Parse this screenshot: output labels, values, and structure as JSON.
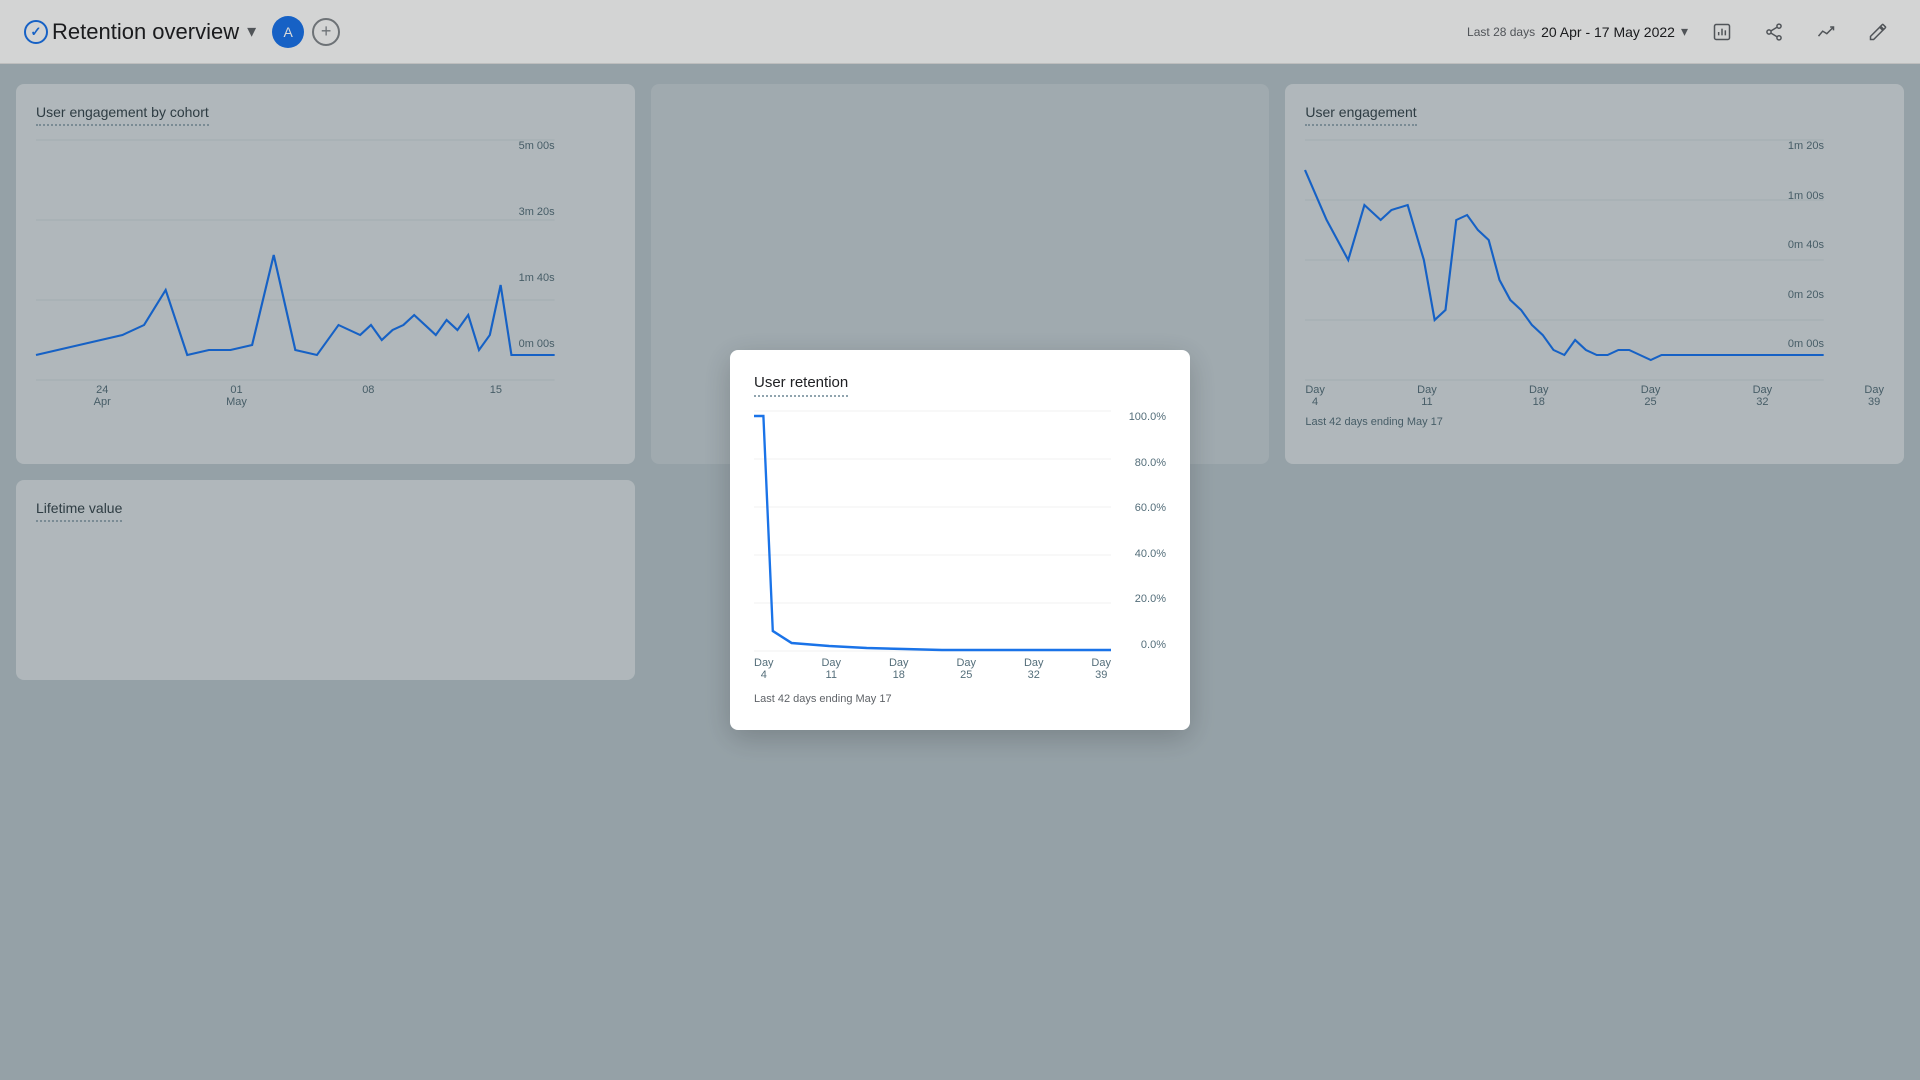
{
  "header": {
    "title": "Retention overview",
    "check_icon": "check-circle-icon",
    "dropdown_icon": "▾",
    "avatar_label": "A",
    "add_icon": "+",
    "date_range_label": "Last 28 days",
    "date_range_value": "20 Apr - 17 May 2022",
    "date_range_arrow": "▾",
    "toolbar_icons": [
      "report-icon",
      "share-icon",
      "trend-icon",
      "edit-icon"
    ]
  },
  "cards": [
    {
      "id": "user-engagement-cohort",
      "title": "User engagement by cohort",
      "y_labels": [
        "5m 00s",
        "3m 20s",
        "1m 40s",
        "0m 00s"
      ],
      "x_labels": [
        {
          "line1": "24",
          "line2": "Apr"
        },
        {
          "line1": "01",
          "line2": "May"
        },
        {
          "line1": "08",
          "line2": ""
        },
        {
          "line1": "15",
          "line2": ""
        }
      ],
      "footer": ""
    },
    {
      "id": "user-engagement",
      "title": "User engagement",
      "y_labels": [
        "1m 20s",
        "1m 00s",
        "0m 40s",
        "0m 20s",
        "0m 00s"
      ],
      "x_labels": [
        {
          "line1": "Day",
          "line2": "4"
        },
        {
          "line1": "Day",
          "line2": "11"
        },
        {
          "line1": "Day",
          "line2": "18"
        },
        {
          "line1": "Day",
          "line2": "25"
        },
        {
          "line1": "Day",
          "line2": "32"
        },
        {
          "line1": "Day",
          "line2": "39"
        }
      ],
      "footer": "Last 42 days ending May 17"
    }
  ],
  "modal": {
    "title": "User retention",
    "y_labels": [
      "100.0%",
      "80.0%",
      "60.0%",
      "40.0%",
      "20.0%",
      "0.0%"
    ],
    "x_labels": [
      {
        "line1": "Day",
        "line2": "4"
      },
      {
        "line1": "Day",
        "line2": "11"
      },
      {
        "line1": "Day",
        "line2": "18"
      },
      {
        "line1": "Day",
        "line2": "25"
      },
      {
        "line1": "Day",
        "line2": "32"
      },
      {
        "line1": "Day",
        "line2": "39"
      }
    ],
    "footer": "Last 42 days ending May 17"
  },
  "bottom_card": {
    "title": "Lifetime value"
  }
}
